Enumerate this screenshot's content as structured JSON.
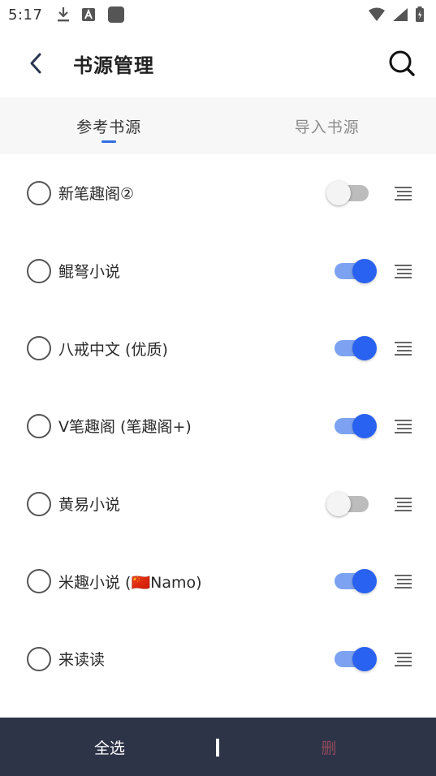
{
  "status_bar": {
    "time": "5:17"
  },
  "app_bar": {
    "title": "书源管理",
    "back_icon": "back-arrow-icon",
    "search_icon": "search-icon"
  },
  "tabs": [
    {
      "label": "参考书源",
      "active": true
    },
    {
      "label": "导入书源",
      "active": false
    }
  ],
  "sources": [
    {
      "name": "新笔趣阁②",
      "enabled": false,
      "selected": false
    },
    {
      "name": "鲲弩小说",
      "enabled": true,
      "selected": false
    },
    {
      "name": "八戒中文 (优质)",
      "enabled": true,
      "selected": false
    },
    {
      "name": "V笔趣阁 (笔趣阁+)",
      "enabled": true,
      "selected": false
    },
    {
      "name": "黄易小说",
      "enabled": false,
      "selected": false
    },
    {
      "name": "米趣小说 (🇨🇳Namo)",
      "enabled": true,
      "selected": false
    },
    {
      "name": "来读读",
      "enabled": true,
      "selected": false
    }
  ],
  "bottom_bar": {
    "select_all_label": "全选",
    "delete_label": "删"
  },
  "colors": {
    "accent": "#2962f0",
    "bottom_bar_bg": "#2d3448"
  }
}
